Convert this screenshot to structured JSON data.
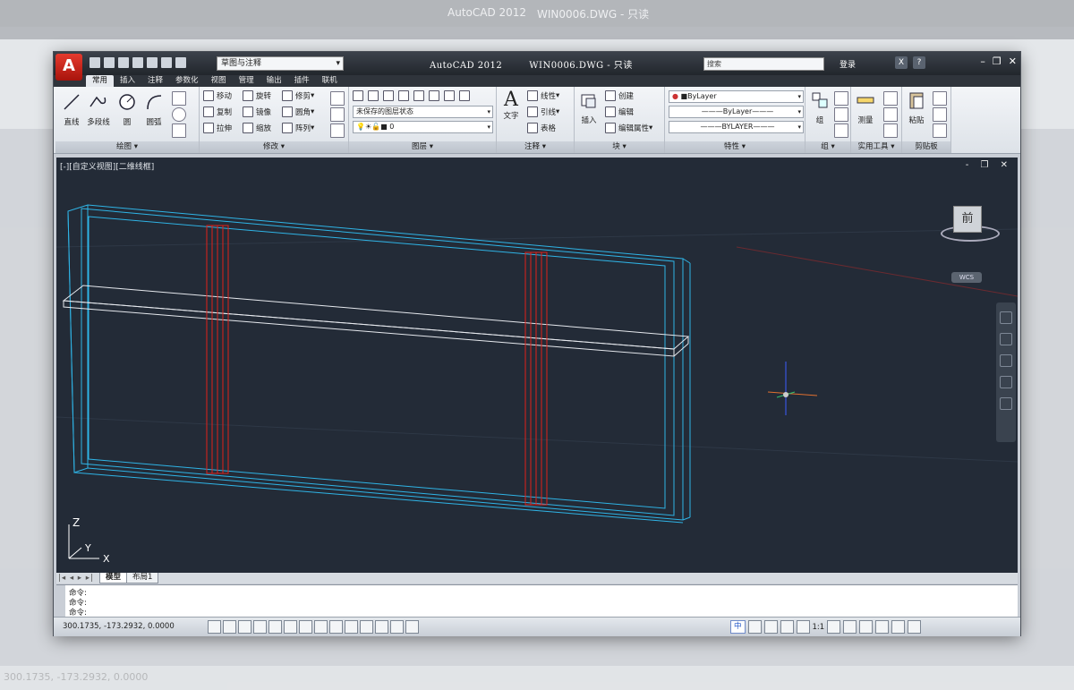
{
  "app": {
    "title": "AutoCAD 2012",
    "file": "WIN0006.DWG - 只读",
    "workspace": "草图与注释",
    "search_placeholder": "搜索",
    "signin": "登录",
    "menu_letter": "A"
  },
  "tabs": [
    "常用",
    "插入",
    "注释",
    "参数化",
    "视图",
    "管理",
    "输出",
    "插件",
    "联机"
  ],
  "ribbon": {
    "draw": {
      "title": "绘图 ▾",
      "line": "直线",
      "polyline": "多段线",
      "circle": "圆",
      "arc": "圆弧"
    },
    "modify": {
      "title": "修改 ▾",
      "move": "移动",
      "rotate": "旋转",
      "trim": "修剪",
      "copy": "复制",
      "mirror": "镜像",
      "fillet": "圆角",
      "stretch": "拉伸",
      "scale": "缩放",
      "array": "阵列"
    },
    "layers": {
      "title": "图层 ▾",
      "state": "未保存的图层状态",
      "current": "0"
    },
    "annotation": {
      "title": "注释 ▾",
      "text": "文字",
      "dimension": "线性",
      "leader": "引线",
      "table": "表格"
    },
    "block": {
      "title": "块 ▾",
      "insert": "插入",
      "create": "创建",
      "edit": "编辑",
      "edit_attr": "编辑属性"
    },
    "properties": {
      "title": "特性 ▾",
      "color": "ByLayer",
      "linetype": "ByLayer",
      "lineweight": "BYLAYER"
    },
    "groups": {
      "title": "组 ▾",
      "group": "组"
    },
    "utilities": {
      "title": "实用工具 ▾",
      "measure": "测量"
    },
    "clipboard": {
      "title": "剪贴板",
      "paste": "粘贴"
    }
  },
  "viewport": {
    "label": "[-][自定义视图][二维线框]",
    "controls": "- ❐ ✕",
    "viewcube_face": "前",
    "wcs": "WCS",
    "ucs_z": "Z",
    "ucs_y": "Y",
    "ucs_x": "X"
  },
  "layout_tabs": {
    "nav": "|◂ ◂ ▸ ▸|",
    "model": "模型",
    "layout1": "布局1"
  },
  "command": {
    "lines": [
      "命令:",
      "命令:",
      "命令:"
    ]
  },
  "status": {
    "coords": "300.1735, -173.2932, 0.0000",
    "ime": "中",
    "scale": "1:1"
  },
  "colors": {
    "viewport": "#232b37",
    "frame": "#2fb4e6",
    "accent": "#e0201a"
  }
}
